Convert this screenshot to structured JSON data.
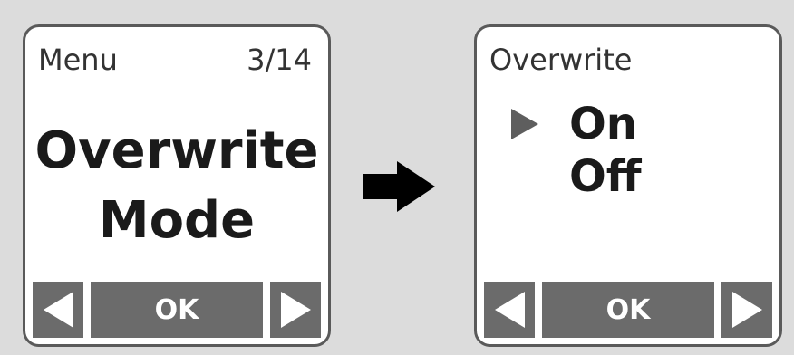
{
  "screens": [
    {
      "header_left": "Menu",
      "header_right": "3/14",
      "title_line1": "Overwrite",
      "title_line2": "Mode",
      "softkeys": {
        "left_icon": "triangle-left",
        "ok_label": "OK",
        "right_icon": "triangle-right"
      }
    },
    {
      "header_left": "Overwrite",
      "options": [
        {
          "label": "On",
          "selected": true
        },
        {
          "label": "Off",
          "selected": false
        }
      ],
      "softkeys": {
        "left_icon": "triangle-left",
        "ok_label": "OK",
        "right_icon": "triangle-right"
      }
    }
  ],
  "transition_icon": "arrow-right",
  "colors": {
    "background": "#dcdcdc",
    "softkey": "#6b6b6b",
    "screen_border": "#5a5a5a",
    "selection_marker": "#5e5e5e",
    "arrow": "#000000"
  }
}
